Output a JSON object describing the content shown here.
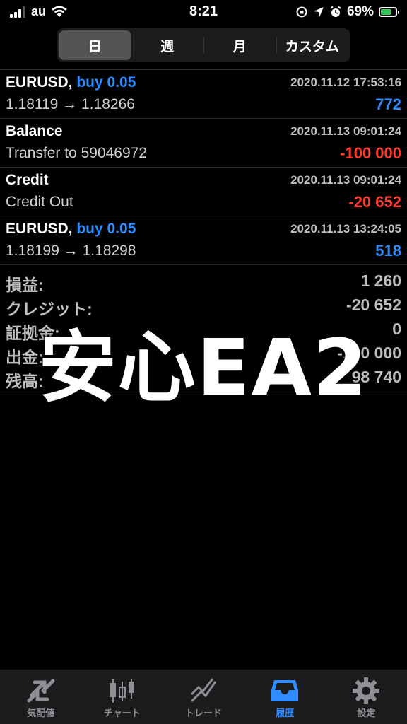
{
  "status_bar": {
    "carrier": "au",
    "time": "8:21",
    "battery_percent": "69%",
    "battery_level": 0.69
  },
  "segments": [
    {
      "label": "日",
      "active": true
    },
    {
      "label": "週",
      "active": false
    },
    {
      "label": "月",
      "active": false
    },
    {
      "label": "カスタム",
      "active": false
    }
  ],
  "transactions": [
    {
      "symbol": "EURUSD,",
      "side": "buy 0.05",
      "date": "2020.11.12 17:53:16",
      "detail": "1.18119 → 1.18266",
      "amount": "772",
      "amount_color": "#2f8cff"
    },
    {
      "symbol": "Balance",
      "side": "",
      "date": "2020.11.13 09:01:24",
      "detail": "Transfer to 59046972",
      "amount": "-100 000",
      "amount_color": "#ff3b30"
    },
    {
      "symbol": "Credit",
      "side": "",
      "date": "2020.11.13 09:01:24",
      "detail": "Credit Out",
      "amount": "-20 652",
      "amount_color": "#ff3b30"
    },
    {
      "symbol": "EURUSD,",
      "side": "buy 0.05",
      "date": "2020.11.13 13:24:05",
      "detail": "1.18199 → 1.18298",
      "amount": "518",
      "amount_color": "#2f8cff"
    }
  ],
  "summary": [
    {
      "label": "損益:",
      "value": "1 260"
    },
    {
      "label": "クレジット:",
      "value": "-20 652"
    },
    {
      "label": "証拠金:",
      "value": "0"
    },
    {
      "label": "出金:",
      "value": "-100 000"
    },
    {
      "label": "残高:",
      "value": "98 740"
    }
  ],
  "watermark": "安心EA2",
  "tabbar": [
    {
      "label": "気配値",
      "icon": "quotes-icon",
      "active": false
    },
    {
      "label": "チャート",
      "icon": "candlestick-chart-icon",
      "active": false
    },
    {
      "label": "トレード",
      "icon": "trade-icon",
      "active": false
    },
    {
      "label": "履歴",
      "icon": "history-inbox-icon",
      "active": true
    },
    {
      "label": "設定",
      "icon": "gear-icon",
      "active": false
    }
  ]
}
